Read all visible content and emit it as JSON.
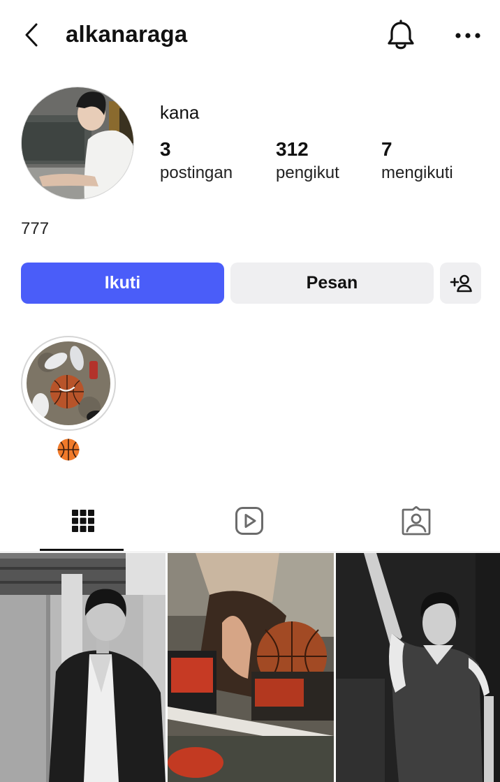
{
  "header": {
    "username": "alkanaraga",
    "back_icon": "chevron-left-icon",
    "bell_icon": "bell-icon",
    "more_icon": "more-horizontal-icon"
  },
  "profile": {
    "display_name": "kana",
    "bio": "777",
    "stats": [
      {
        "value": "3",
        "label": "postingan"
      },
      {
        "value": "312",
        "label": "pengikut"
      },
      {
        "value": "7",
        "label": "mengikuti"
      }
    ]
  },
  "actions": {
    "follow_label": "Ikuti",
    "message_label": "Pesan",
    "suggest_icon": "add-person-icon"
  },
  "highlights": [
    {
      "cover": "basketball-and-sneakers-photo",
      "label_icon": "basketball-emoji"
    }
  ],
  "tabs": [
    {
      "icon": "grid-icon",
      "active": true
    },
    {
      "icon": "reels-icon",
      "active": false
    },
    {
      "icon": "tagged-icon",
      "active": false
    }
  ],
  "posts": [
    {
      "subject": "man-in-black-blazer-photo"
    },
    {
      "subject": "seated-player-with-basketball-photo"
    },
    {
      "subject": "player-in-jersey-waving-photo"
    }
  ],
  "colors": {
    "accent": "#4a5df9",
    "secondary_button": "#efeff1",
    "text": "#111111"
  }
}
